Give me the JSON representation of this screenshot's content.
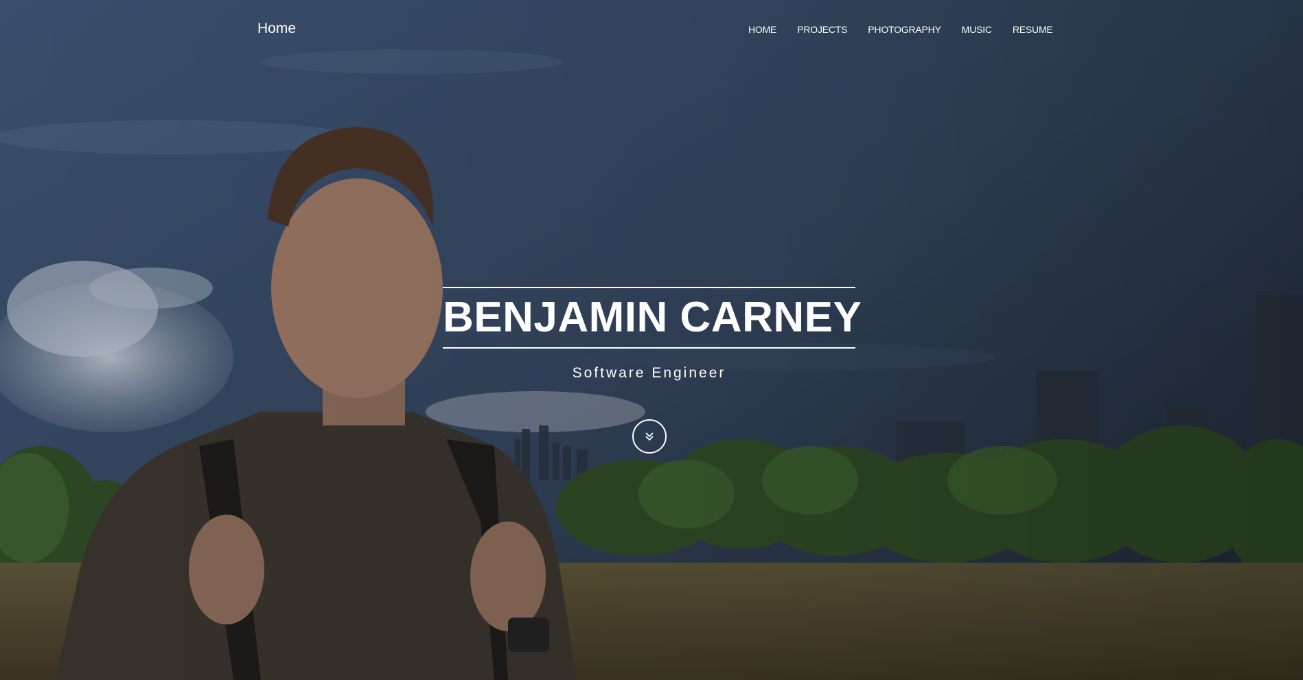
{
  "header": {
    "brand": "Home",
    "nav": [
      {
        "label": "HOME"
      },
      {
        "label": "PROJECTS"
      },
      {
        "label": "PHOTOGRAPHY"
      },
      {
        "label": "MUSIC"
      },
      {
        "label": "RESUME"
      }
    ]
  },
  "hero": {
    "name": "BENJAMIN CARNEY",
    "subtitle": "Software Engineer",
    "scroll_icon": "double-chevron-down-icon"
  },
  "colors": {
    "text": "#ffffff",
    "sky": "#33445d",
    "grass": "#4a4530"
  }
}
